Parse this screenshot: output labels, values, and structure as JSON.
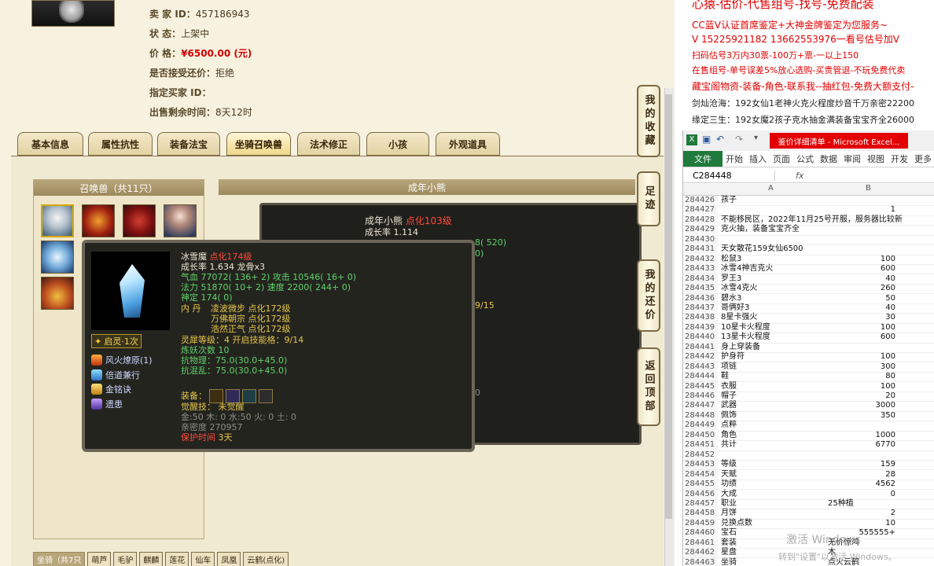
{
  "seller": {
    "id_label": "卖 家 ID：",
    "id_value": "457186943",
    "status_label": "状 态：",
    "status_value": "上架中",
    "price_label": "价 格：",
    "price_value": "¥6500.00 (元)",
    "bargain_label": "是否接受还价：",
    "bargain_value": "拒绝",
    "buyer_label": "指定买家 ID：",
    "buyer_value": "",
    "time_label": "出售剩余时间：",
    "time_value": "8天12时"
  },
  "tabs": [
    "基本信息",
    "属性抗性",
    "装备法宝",
    "坐骑召唤兽",
    "法术修正",
    "小孩",
    "外观道具"
  ],
  "active_tab": "坐骑召唤兽",
  "pets_header": "召唤兽（共11只）",
  "right_header": "成年小熊",
  "bg_pet": {
    "name": "成年小熊",
    "tag": "点化103级",
    "growth": "成长率 1.114",
    "frag1": "8( 520)",
    "frag2": "0)",
    "frag3": "9/15",
    "frag4": "0"
  },
  "tooltip": {
    "name": "冰雪魔",
    "tag": "点化174级",
    "growth": "成长率 1.634 龙骨x3",
    "hp": "气血 77072( 136+ 2)",
    "atk": "攻击 10546( 16+ 0)",
    "mp": "法力 51870( 10+ 2)",
    "spd": "速度 2200( 244+ 0)",
    "def": "神定 174( 0)",
    "neidan_label": "内 丹",
    "neidan": [
      "凌波微步 点化172级",
      "万佛朝宗 点化172级",
      "浩然正气 点化172级"
    ],
    "soul": "灵犀等级：4 开启技能格：9/14",
    "refine": "炼妖次数 10",
    "res1": "抗物理：75.0(30.0+45.0)",
    "res2": "抗混乱：75.0(30.0+45.0)",
    "equip_label": "装备：",
    "awaken": "觉醒技： 未觉醒",
    "elements": "金:50 木: 0 水:50 火: 0 土: 0",
    "intimacy": "亲密度 270957",
    "protect_label": "保护时间",
    "protect_value": "3天",
    "badge": "启灵·1次",
    "skills": [
      "风火燎原(1)",
      "倍道兼行",
      "金铭诀",
      "遗患"
    ]
  },
  "side_buttons": [
    "我的收藏",
    "足迹",
    "我的还价",
    "返回顶部"
  ],
  "bottom": {
    "label": "坐骑（共7只",
    "tags": [
      "萌芦",
      "毛驴",
      "麒麟",
      "莲花",
      "仙车",
      "凤凰",
      "云鹤(点化)"
    ]
  },
  "ad": {
    "title": "心猿-估价-代售组号-找号-免费配装",
    "lines": [
      "CC蓝V认证首席鉴定+大神金牌鉴定为您服务~",
      "V 15225921182 13662553976一看号估号加V",
      "扫码估号3万内30票-100万+票-一以上150",
      "在售组号-单号误差5%放心选购-买贵管退-不玩免费代卖",
      "藏宝阁物资-装备-角色-联系我--抽红包-免费大额支付-",
      "剑灿沧海：192女仙1老神火克火程度炒音千万亲密22200",
      "缘定三生：192女魔2孩子克水抽金满装备宝宝齐全26000"
    ]
  },
  "excel": {
    "title": "鉴价详细清单 - Microsoft Excel...",
    "tabs": [
      "文件",
      "开始",
      "插入",
      "页面",
      "公式",
      "数据",
      "审阅",
      "视图",
      "开发",
      "更多"
    ],
    "cellref": "C284448",
    "fx": "fx",
    "col_a": "A",
    "col_b": "B",
    "rows": [
      [
        "284426",
        "孩子",
        ""
      ],
      [
        "284427",
        "",
        "1"
      ],
      [
        "284428",
        "不能移民区，2022年11月25号开服，服务器比较新",
        ""
      ],
      [
        "284429",
        "克火抽，装备宝宝齐全",
        ""
      ],
      [
        "284430",
        "",
        ""
      ],
      [
        "284431",
        "天女散花159女仙6500",
        ""
      ],
      [
        "284432",
        "松鼠3",
        "100"
      ],
      [
        "284433",
        "冰雪4神吉克火",
        "600"
      ],
      [
        "284434",
        "罗王3",
        "40"
      ],
      [
        "284435",
        "冰雪4克火",
        "260"
      ],
      [
        "284436",
        "碧水3",
        "50"
      ],
      [
        "284437",
        "哥俩好3",
        "40"
      ],
      [
        "284438",
        "8星卡强火",
        "30"
      ],
      [
        "284439",
        "10星卡火程度",
        "100"
      ],
      [
        "284440",
        "13星卡火程度",
        "600"
      ],
      [
        "284441",
        "身上穿装备",
        ""
      ],
      [
        "284442",
        "护身符",
        "100"
      ],
      [
        "284443",
        "项链",
        "300"
      ],
      [
        "284444",
        "鞋",
        "80"
      ],
      [
        "284445",
        "衣服",
        "100"
      ],
      [
        "284446",
        "帽子",
        "20"
      ],
      [
        "284447",
        "武器",
        "3000"
      ],
      [
        "284448",
        "佩饰",
        "350"
      ],
      [
        "284449",
        "点粹",
        ""
      ],
      [
        "284450",
        "角色",
        "1000"
      ],
      [
        "284451",
        "共计",
        "6770"
      ],
      [
        "284452",
        "",
        ""
      ],
      [
        "284453",
        "等级",
        "159"
      ],
      [
        "284454",
        "天赋",
        "28"
      ],
      [
        "284455",
        "功绩",
        "4562"
      ],
      [
        "284456",
        "大成",
        "0"
      ],
      [
        "284457",
        "职业",
        "25种植"
      ],
      [
        "284458",
        "月饼",
        "2"
      ],
      [
        "284459",
        "兑换点数",
        "10"
      ],
      [
        "284460",
        "宝石",
        "555555+"
      ],
      [
        "284461",
        "套装",
        "无价惊鸿"
      ],
      [
        "284462",
        "星盘",
        "木"
      ],
      [
        "284463",
        "坐骑",
        "点火云鹤"
      ]
    ]
  },
  "watermark": {
    "line1": "激活 Windows",
    "line2": "转到\"设置\"以激活 Windows。"
  }
}
